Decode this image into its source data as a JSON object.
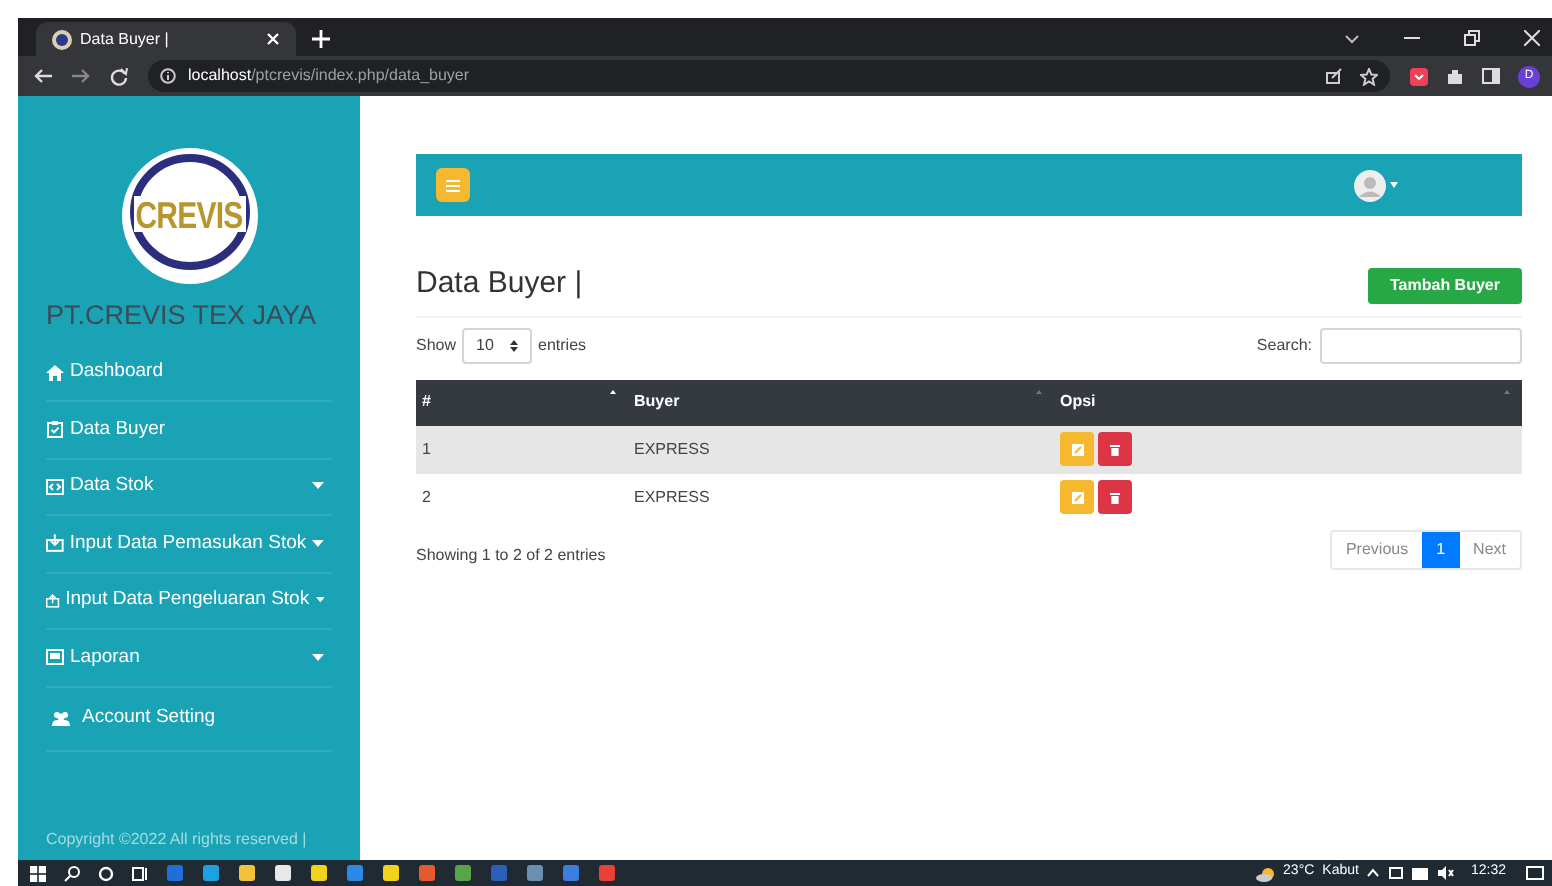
{
  "browser": {
    "tab_title": "Data Buyer |",
    "url_host": "localhost",
    "url_path": "/ptcrevis/index.php/data_buyer",
    "profile_initial": "D"
  },
  "sidebar": {
    "logo_text": "CREVIS",
    "company": "PT.CREVIS TEX JAYA",
    "items": [
      {
        "label": "Dashboard",
        "kind": "home",
        "dropdown": false
      },
      {
        "label": "Data Buyer",
        "kind": "clipboard",
        "dropdown": false
      },
      {
        "label": "Data Stok",
        "kind": "code",
        "dropdown": true
      },
      {
        "label": "Input Data Pemasukan Stok",
        "kind": "inbox",
        "dropdown": true
      },
      {
        "label": "Input Data Pengeluaran Stok",
        "kind": "outbox",
        "dropdown": true
      },
      {
        "label": "Laporan",
        "kind": "card",
        "dropdown": true
      },
      {
        "label": "Account Setting",
        "kind": "users",
        "dropdown": false
      }
    ],
    "copyright": "Copyright ©2022 All rights reserved |"
  },
  "page": {
    "title": "Data Buyer |",
    "add_button": "Tambah Buyer",
    "show_label": "Show",
    "page_size": "10",
    "entries_label": "entries",
    "search_label": "Search:",
    "table": {
      "columns": [
        "#",
        "Buyer",
        "Opsi"
      ],
      "rows": [
        {
          "cells": [
            "1",
            "EXPRESS"
          ]
        },
        {
          "cells": [
            "2",
            "EXPRESS"
          ]
        }
      ]
    },
    "info": "Showing 1 to 2 of 2 entries",
    "pagination": [
      {
        "label": "Previous",
        "selected": false
      },
      {
        "label": "1",
        "selected": true
      },
      {
        "label": "Next",
        "selected": false
      }
    ]
  },
  "taskbar": {
    "temperature": "23°C",
    "weather": "Kabut",
    "time": "12:32"
  }
}
